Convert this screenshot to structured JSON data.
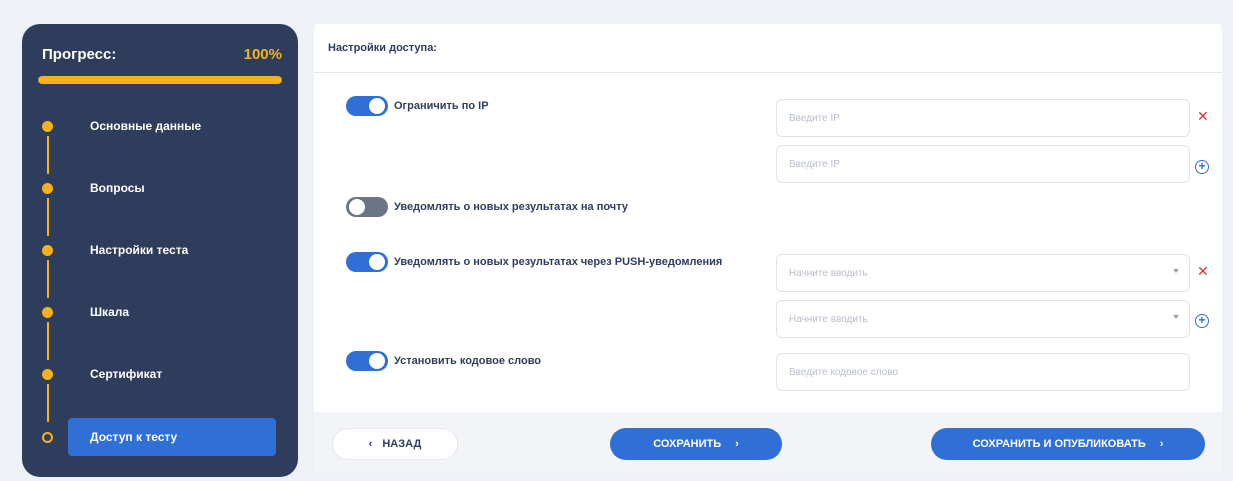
{
  "sidebar": {
    "progress_label": "Прогресс:",
    "progress_value": "100%",
    "progress_fraction": 1.0,
    "steps": [
      {
        "label": "Основные данные",
        "done": true
      },
      {
        "label": "Вопросы",
        "done": true
      },
      {
        "label": "Настройки теста",
        "done": true
      },
      {
        "label": "Шкала",
        "done": true
      },
      {
        "label": "Сертификат",
        "done": true
      },
      {
        "label": "Доступ к тесту",
        "done": false,
        "active": true
      }
    ]
  },
  "card": {
    "title": "Настройки доступа:",
    "ip_toggle": {
      "label": "Ограничить по IP",
      "on": true
    },
    "ip_fields": [
      {
        "placeholder": "Введите IP"
      },
      {
        "placeholder": "Введите IP"
      }
    ],
    "email_toggle": {
      "label": "Уведомлять о новых результатах на почту",
      "on": false
    },
    "push_toggle": {
      "label": "Уведомлять о новых результатах через PUSH-уведомления",
      "on": true
    },
    "push_fields": [
      {
        "placeholder": "Начните вводить"
      },
      {
        "placeholder": "Начните вводить"
      }
    ],
    "code_toggle": {
      "label": "Установить кодовое слово",
      "on": true
    },
    "code_field": {
      "placeholder": "Введите кодовое слово"
    }
  },
  "footer": {
    "back_label": "НАЗАД",
    "save_label": "СОХРАНИТЬ",
    "publish_label": "СОХРАНИТЬ И ОПУБЛИКОВАТЬ"
  },
  "icons": {
    "remove": "close-icon",
    "add": "plus-circle-icon",
    "dropdown": "chevron-down-icon"
  },
  "colors": {
    "sidebar_bg": "#2f3d5c",
    "accent_yellow": "#f5b21a",
    "primary_blue": "#2f6fd6",
    "remove_red": "#e0322b"
  }
}
